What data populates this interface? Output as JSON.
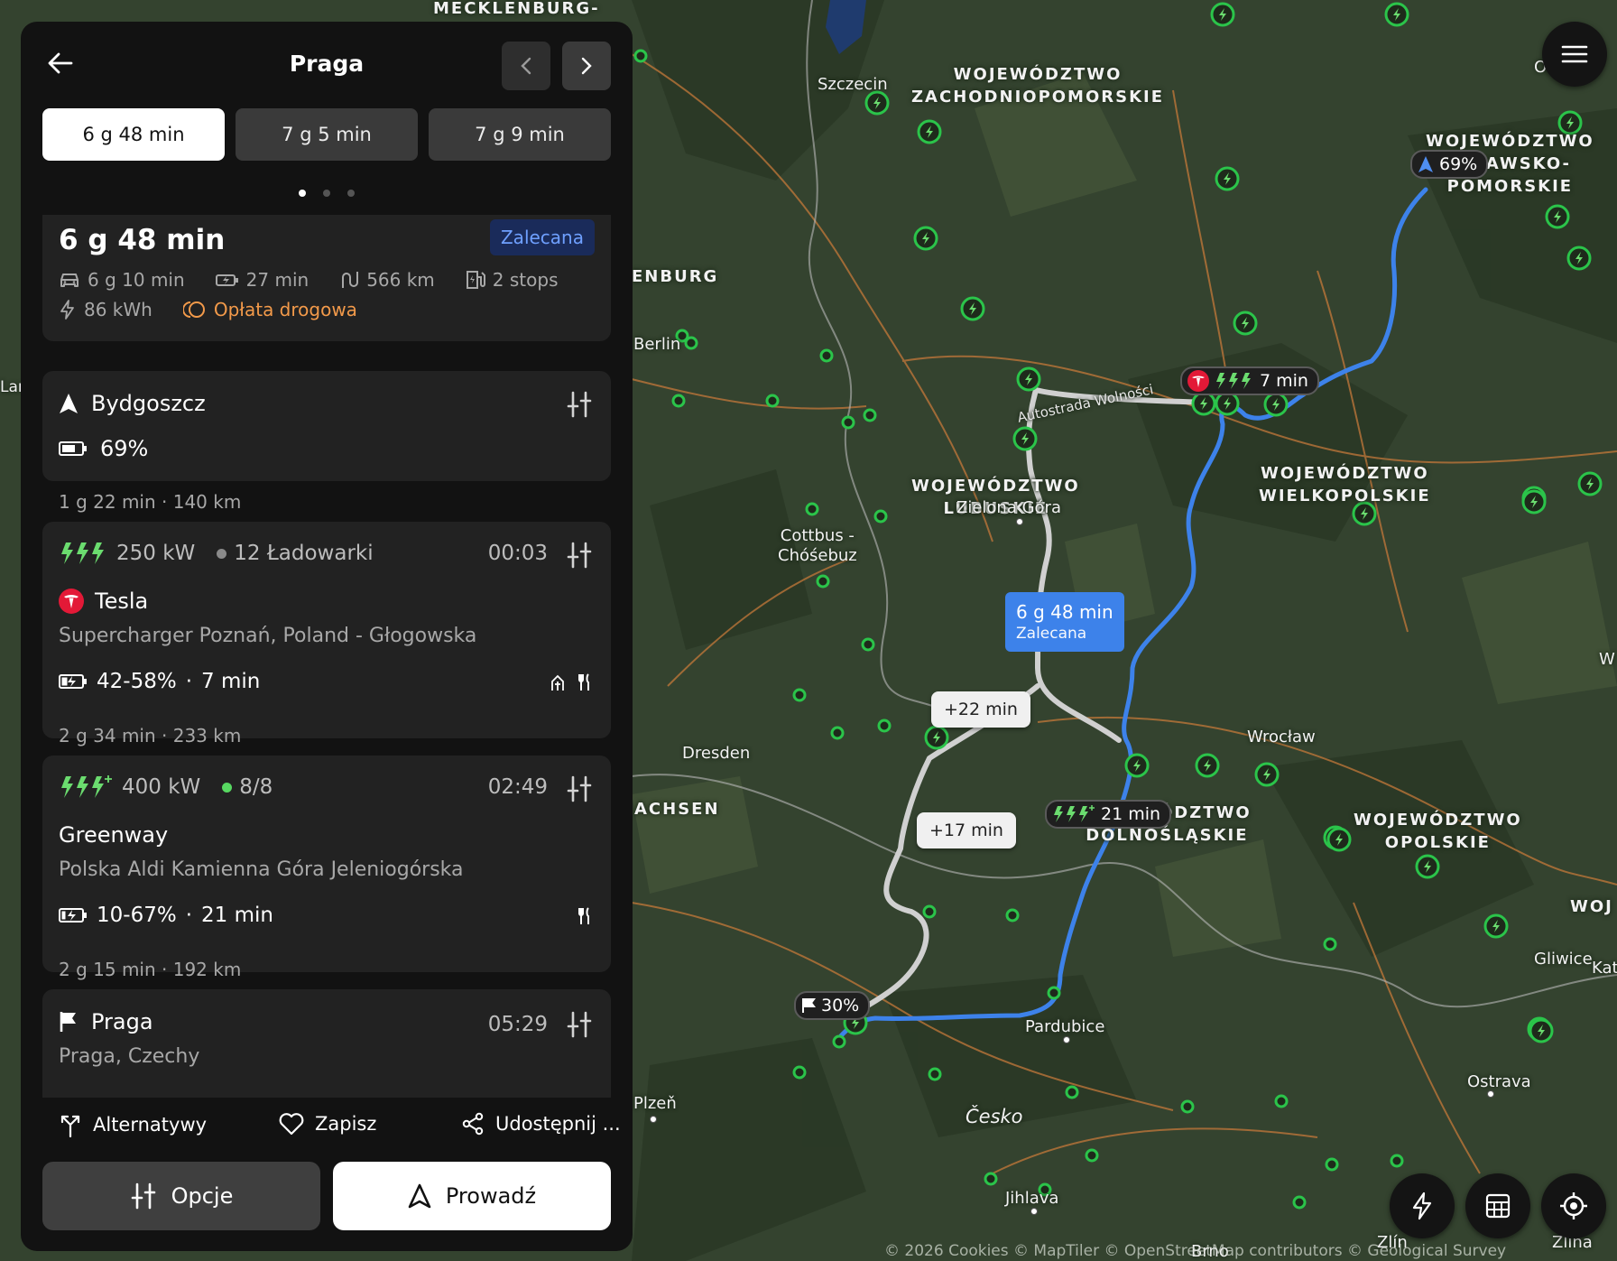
{
  "panel": {
    "title": "Praga",
    "tabs": [
      {
        "label": "6 g 48 min",
        "active": true
      },
      {
        "label": "7 g 5 min",
        "active": false
      },
      {
        "label": "7 g 9 min",
        "active": false
      }
    ],
    "page_count": 3,
    "summary": {
      "time": "6 g 48 min",
      "badge": "Zalecana",
      "drive": "6 g 10 min",
      "charge": "27 min",
      "distance": "566 km",
      "stops": "2 stops",
      "energy": "86 kWh",
      "toll": "Opłata drogowa"
    },
    "origin": {
      "name": "Bydgoszcz",
      "battery": "69%"
    },
    "segment1": "1 g 22 min · 140 km",
    "stop1": {
      "power": "250 kW",
      "chargers": "12 Ładowarki",
      "time": "00:03",
      "brand": "Tesla",
      "location": "Supercharger Poznań, Poland - Głogowska",
      "charge_range": "42-58%",
      "charge_time": "7 min"
    },
    "segment2": "2 g 34 min · 233 km",
    "stop2": {
      "power": "400 kW",
      "chargers": "8/8",
      "time": "02:49",
      "brand": "Greenway",
      "location": "Polska Aldi Kamienna Góra Jeleniogórska",
      "charge_range": "10-67%",
      "charge_time": "21 min"
    },
    "segment3": "2 g 15 min · 192 km",
    "destination": {
      "name": "Praga",
      "subtitle": "Praga, Czechy",
      "time": "05:29"
    },
    "actions": {
      "alternatives": "Alternatywy",
      "save": "Zapisz",
      "share": "Udostępnij ..."
    },
    "buttons": {
      "options": "Opcje",
      "navigate": "Prowadź"
    }
  },
  "map": {
    "regions": [
      "MECKLENBURG-",
      "WOJEWÓDZTWO\nZACHODNIOPOMORSKIE",
      "WOJEWÓDZTWO\nKUJAWSKO-\nPOMORSKIE",
      "ENBURG",
      "WOJEWÓDZTWO\nLUBUSKIE",
      "WOJEWÓDZTWO\nWIELKOPOLSKIE",
      "ACHSEN",
      "WOJEWÓDZTWO\nDOLNOŚLĄSKIE",
      "WOJEWÓDZTWO\nOPOLSKIE",
      "WOJ"
    ],
    "cities": [
      "Szczecin",
      "Berlin",
      "Cottbus -\nChóśebuz",
      "Zielona Góra",
      "Dresden",
      "Wrocław",
      "Pardubice",
      "Plzeň",
      "Česko",
      "Jihlava",
      "Ostrava",
      "Gliwice",
      "Kato",
      "Brno",
      "Zlín",
      "Zlína",
      "Lan",
      "W",
      "Olsz"
    ],
    "road_label": "Autostrada Wolności",
    "markers": {
      "start_battery": "69%",
      "stop1_time": "7 min",
      "stop2_time": "21 min",
      "end_battery": "30%",
      "route_time": "6 g 48 min",
      "route_badge": "Zalecana",
      "alt1": "+22 min",
      "alt2": "+17 min"
    },
    "attribution": "© 2026  Cookies  © MapTiler  © OpenStreetMap contributors  © Geological Survey"
  },
  "colors": {
    "route": "#3d82ea",
    "alt_route": "#cccccc",
    "charger": "#2bc44a",
    "accent": "#6fa0ff",
    "toll": "#f39a4a",
    "tesla": "#e31937"
  }
}
